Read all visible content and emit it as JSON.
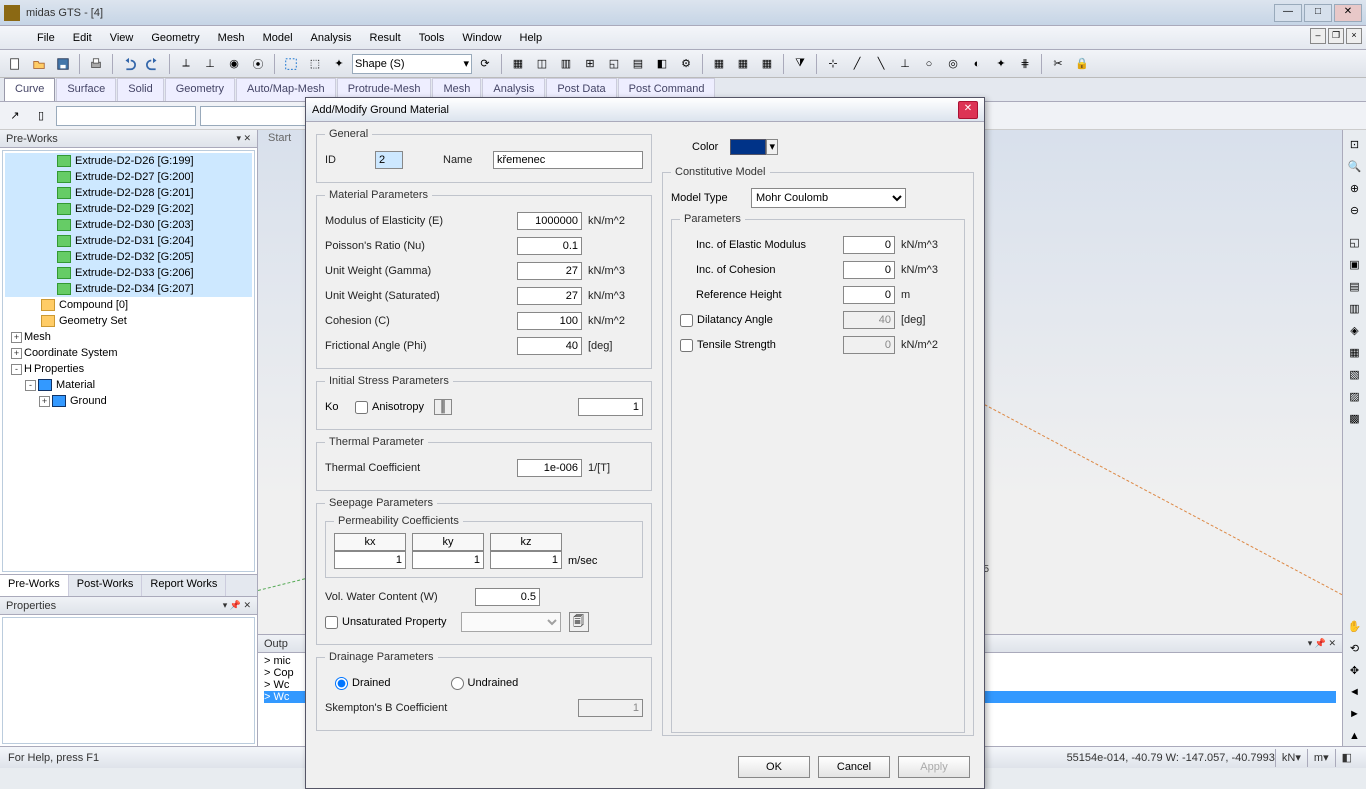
{
  "app": {
    "title": "midas GTS - [4]"
  },
  "menu": [
    "File",
    "Edit",
    "View",
    "Geometry",
    "Mesh",
    "Model",
    "Analysis",
    "Result",
    "Tools",
    "Window",
    "Help"
  ],
  "toolbar_shape": "Shape (S)",
  "ribbon_tabs": [
    "Curve",
    "Surface",
    "Solid",
    "Geometry",
    "Auto/Map-Mesh",
    "Protrude-Mesh",
    "Mesh",
    "Analysis",
    "Post Data",
    "Post Command"
  ],
  "ribbon_active": 0,
  "left": {
    "header": "Pre-Works",
    "tree": [
      {
        "indent": 52,
        "icon": "geom",
        "label": "Extrude-D2-D26 [G:199]"
      },
      {
        "indent": 52,
        "icon": "geom",
        "label": "Extrude-D2-D27 [G:200]"
      },
      {
        "indent": 52,
        "icon": "geom",
        "label": "Extrude-D2-D28 [G:201]"
      },
      {
        "indent": 52,
        "icon": "geom",
        "label": "Extrude-D2-D29 [G:202]"
      },
      {
        "indent": 52,
        "icon": "geom",
        "label": "Extrude-D2-D30 [G:203]"
      },
      {
        "indent": 52,
        "icon": "geom",
        "label": "Extrude-D2-D31 [G:204]"
      },
      {
        "indent": 52,
        "icon": "geom",
        "label": "Extrude-D2-D32 [G:205]"
      },
      {
        "indent": 52,
        "icon": "geom",
        "label": "Extrude-D2-D33 [G:206]"
      },
      {
        "indent": 52,
        "icon": "geom",
        "label": "Extrude-D2-D34 [G:207]"
      },
      {
        "indent": 36,
        "icon": "folder",
        "label": "Compound [0]"
      },
      {
        "indent": 36,
        "icon": "folder",
        "label": "Geometry Set"
      },
      {
        "indent": 6,
        "exp": "+",
        "icon": "",
        "label": "Mesh"
      },
      {
        "indent": 6,
        "exp": "+",
        "icon": "",
        "label": "Coordinate System"
      },
      {
        "indent": 6,
        "exp": "-",
        "icon": "",
        "label": "Properties",
        "prefix": "H"
      },
      {
        "indent": 20,
        "exp": "-",
        "icon": "mat",
        "label": "Material"
      },
      {
        "indent": 34,
        "exp": "+",
        "icon": "mat",
        "label": "Ground"
      }
    ],
    "bottom_tabs": [
      "Pre-Works",
      "Post-Works",
      "Report Works"
    ],
    "bottom_active": 0,
    "props_header": "Properties"
  },
  "output": {
    "header": "Outp",
    "lines": [
      "> mic",
      "> Cop",
      "> Wc",
      "> Wc"
    ],
    "sel": 3
  },
  "statusbar": {
    "help": "For Help, press F1",
    "coords": "55154e-014, -40.79 W: -147.057, -40.7993",
    "unit1": "kN",
    "unit2": "m"
  },
  "dialog": {
    "title": "Add/Modify Ground Material",
    "general": {
      "legend": "General",
      "id_label": "ID",
      "id": "2",
      "name_label": "Name",
      "name": "křemenec",
      "color_label": "Color",
      "color": "#003388"
    },
    "matparams": {
      "legend": "Material Parameters",
      "rows": [
        {
          "label": "Modulus of Elasticity (E)",
          "value": "1000000",
          "unit": "kN/m^2"
        },
        {
          "label": "Poisson's Ratio (Nu)",
          "value": "0.1",
          "unit": ""
        },
        {
          "label": "Unit Weight (Gamma)",
          "value": "27",
          "unit": "kN/m^3"
        },
        {
          "label": "Unit Weight (Saturated)",
          "value": "27",
          "unit": "kN/m^3"
        },
        {
          "label": "Cohesion (C)",
          "value": "100",
          "unit": "kN/m^2"
        },
        {
          "label": "Frictional Angle (Phi)",
          "value": "40",
          "unit": "[deg]"
        }
      ]
    },
    "initstress": {
      "legend": "Initial Stress Parameters",
      "ko_label": "Ko",
      "aniso_label": "Anisotropy",
      "ko_val": "1"
    },
    "thermal": {
      "legend": "Thermal Parameter",
      "coef_label": "Thermal Coefficient",
      "coef_val": "1e-006",
      "coef_unit": "1/[T]"
    },
    "seepage": {
      "legend": "Seepage Parameters",
      "perm_legend": "Permeability Coefficients",
      "perm_heads": [
        "kx",
        "ky",
        "kz"
      ],
      "perm_vals": [
        "1",
        "1",
        "1"
      ],
      "perm_unit": "m/sec",
      "volw_label": "Vol. Water Content (W)",
      "volw_val": "0.5",
      "unsat_label": "Unsaturated Property"
    },
    "drainage": {
      "legend": "Drainage Parameters",
      "drained": "Drained",
      "undrained": "Undrained",
      "skempton_label": "Skempton's B Coefficient",
      "skempton_val": "1"
    },
    "constitutive": {
      "legend": "Constitutive Model",
      "type_label": "Model Type",
      "type_val": "Mohr Coulomb",
      "params_legend": "Parameters",
      "rows": [
        {
          "label": "Inc. of Elastic Modulus",
          "value": "0",
          "unit": "kN/m^3",
          "check": false
        },
        {
          "label": "Inc. of Cohesion",
          "value": "0",
          "unit": "kN/m^3",
          "check": false
        },
        {
          "label": "Reference Height",
          "value": "0",
          "unit": "m",
          "check": false
        },
        {
          "label": "Dilatancy Angle",
          "value": "40",
          "unit": "[deg]",
          "check": true,
          "disabled": true
        },
        {
          "label": "Tensile Strength",
          "value": "0",
          "unit": "kN/m^2",
          "check": true,
          "disabled": true
        }
      ]
    },
    "buttons": {
      "ok": "OK",
      "cancel": "Cancel",
      "apply": "Apply"
    }
  },
  "viewport": {
    "coord_label": "15"
  }
}
